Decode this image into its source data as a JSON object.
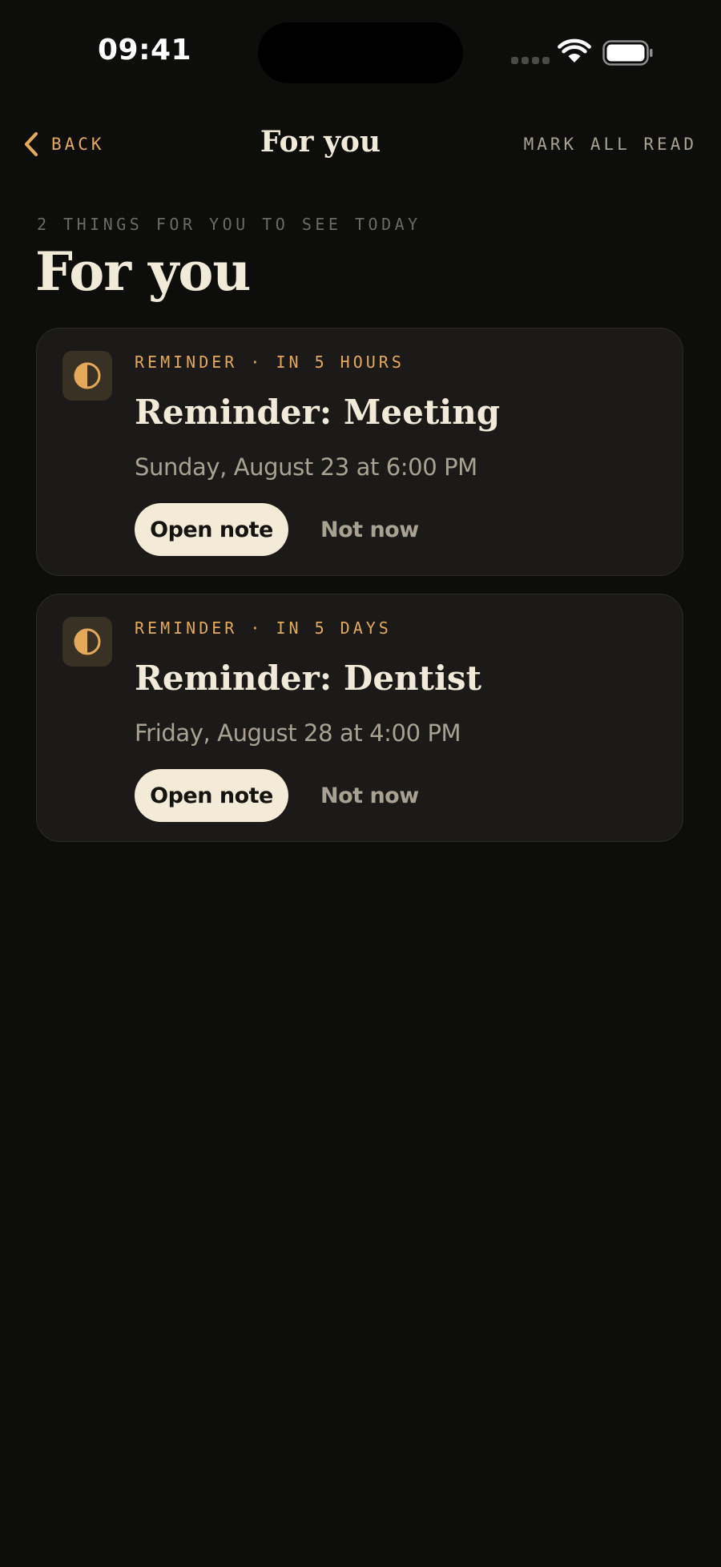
{
  "status_bar": {
    "time": "09:41"
  },
  "nav": {
    "back_label": "BACK",
    "title": "For you",
    "mark_all_label": "MARK ALL READ"
  },
  "header": {
    "eyebrow": "2 THINGS FOR YOU TO SEE TODAY",
    "title": "For you"
  },
  "cards": [
    {
      "icon": "half-circle-icon",
      "meta": "REMINDER · IN 5 HOURS",
      "title": "Reminder: Meeting",
      "date": "Sunday, August 23 at 6:00 PM",
      "primary_label": "Open note",
      "secondary_label": "Not now"
    },
    {
      "icon": "half-circle-icon",
      "meta": "REMINDER · IN 5 DAYS",
      "title": "Reminder: Dentist",
      "date": "Friday, August 28 at 4:00 PM",
      "primary_label": "Open note",
      "secondary_label": "Not now"
    }
  ],
  "colors": {
    "background": "#0d0d0c",
    "accent": "#e5a95a",
    "card": "#1b1a18",
    "text_primary": "#f2ead9",
    "text_secondary": "#a9a292",
    "button_fill": "#f3ead8"
  }
}
